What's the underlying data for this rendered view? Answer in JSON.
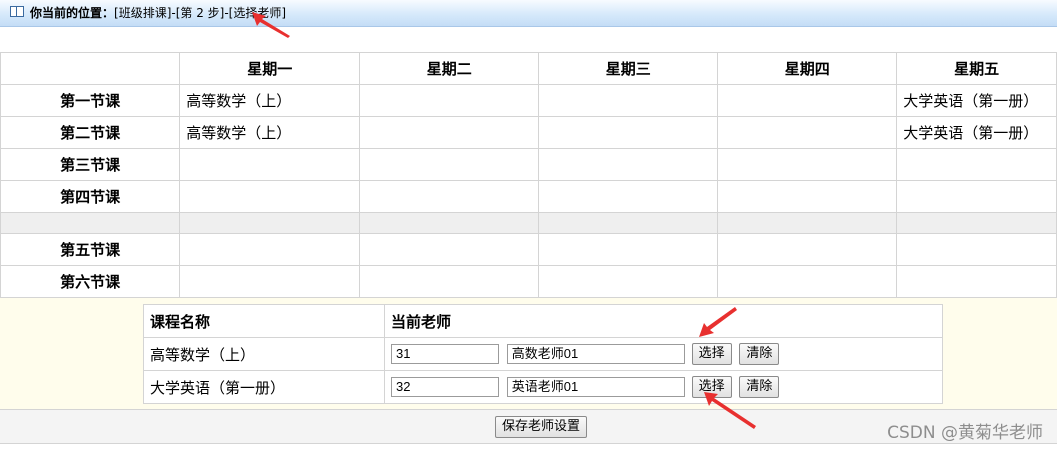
{
  "breadcrumb": {
    "label": "你当前的位置：",
    "path": "[班级排课]-[第 2 步]-[选择老师]"
  },
  "schedule": {
    "days": [
      "星期一",
      "星期二",
      "星期三",
      "星期四",
      "星期五"
    ],
    "rows": [
      {
        "period": "第一节课",
        "cells": [
          "高等数学（上）",
          "",
          "",
          "",
          "大学英语（第一册）"
        ]
      },
      {
        "period": "第二节课",
        "cells": [
          "高等数学（上）",
          "",
          "",
          "",
          "大学英语（第一册）"
        ]
      },
      {
        "period": "第三节课",
        "cells": [
          "",
          "",
          "",
          "",
          ""
        ]
      },
      {
        "period": "第四节课",
        "cells": [
          "",
          "",
          "",
          "",
          ""
        ]
      },
      {
        "period": "第五节课",
        "cells": [
          "",
          "",
          "",
          "",
          ""
        ]
      },
      {
        "period": "第六节课",
        "cells": [
          "",
          "",
          "",
          "",
          ""
        ]
      }
    ]
  },
  "teachers": {
    "col_course": "课程名称",
    "col_teacher": "当前老师",
    "rows": [
      {
        "course": "高等数学（上）",
        "teacher_id": "31",
        "teacher_name": "高数老师01",
        "select_label": "选择",
        "clear_label": "清除"
      },
      {
        "course": "大学英语（第一册）",
        "teacher_id": "32",
        "teacher_name": "英语老师01",
        "select_label": "选择",
        "clear_label": "清除"
      }
    ]
  },
  "save_label": "保存老师设置",
  "watermark": "CSDN @黄菊华老师",
  "colors": {
    "arrow": "#e8302f",
    "header_bg": "#d6e9fb",
    "panel_bg": "#fffdec"
  }
}
